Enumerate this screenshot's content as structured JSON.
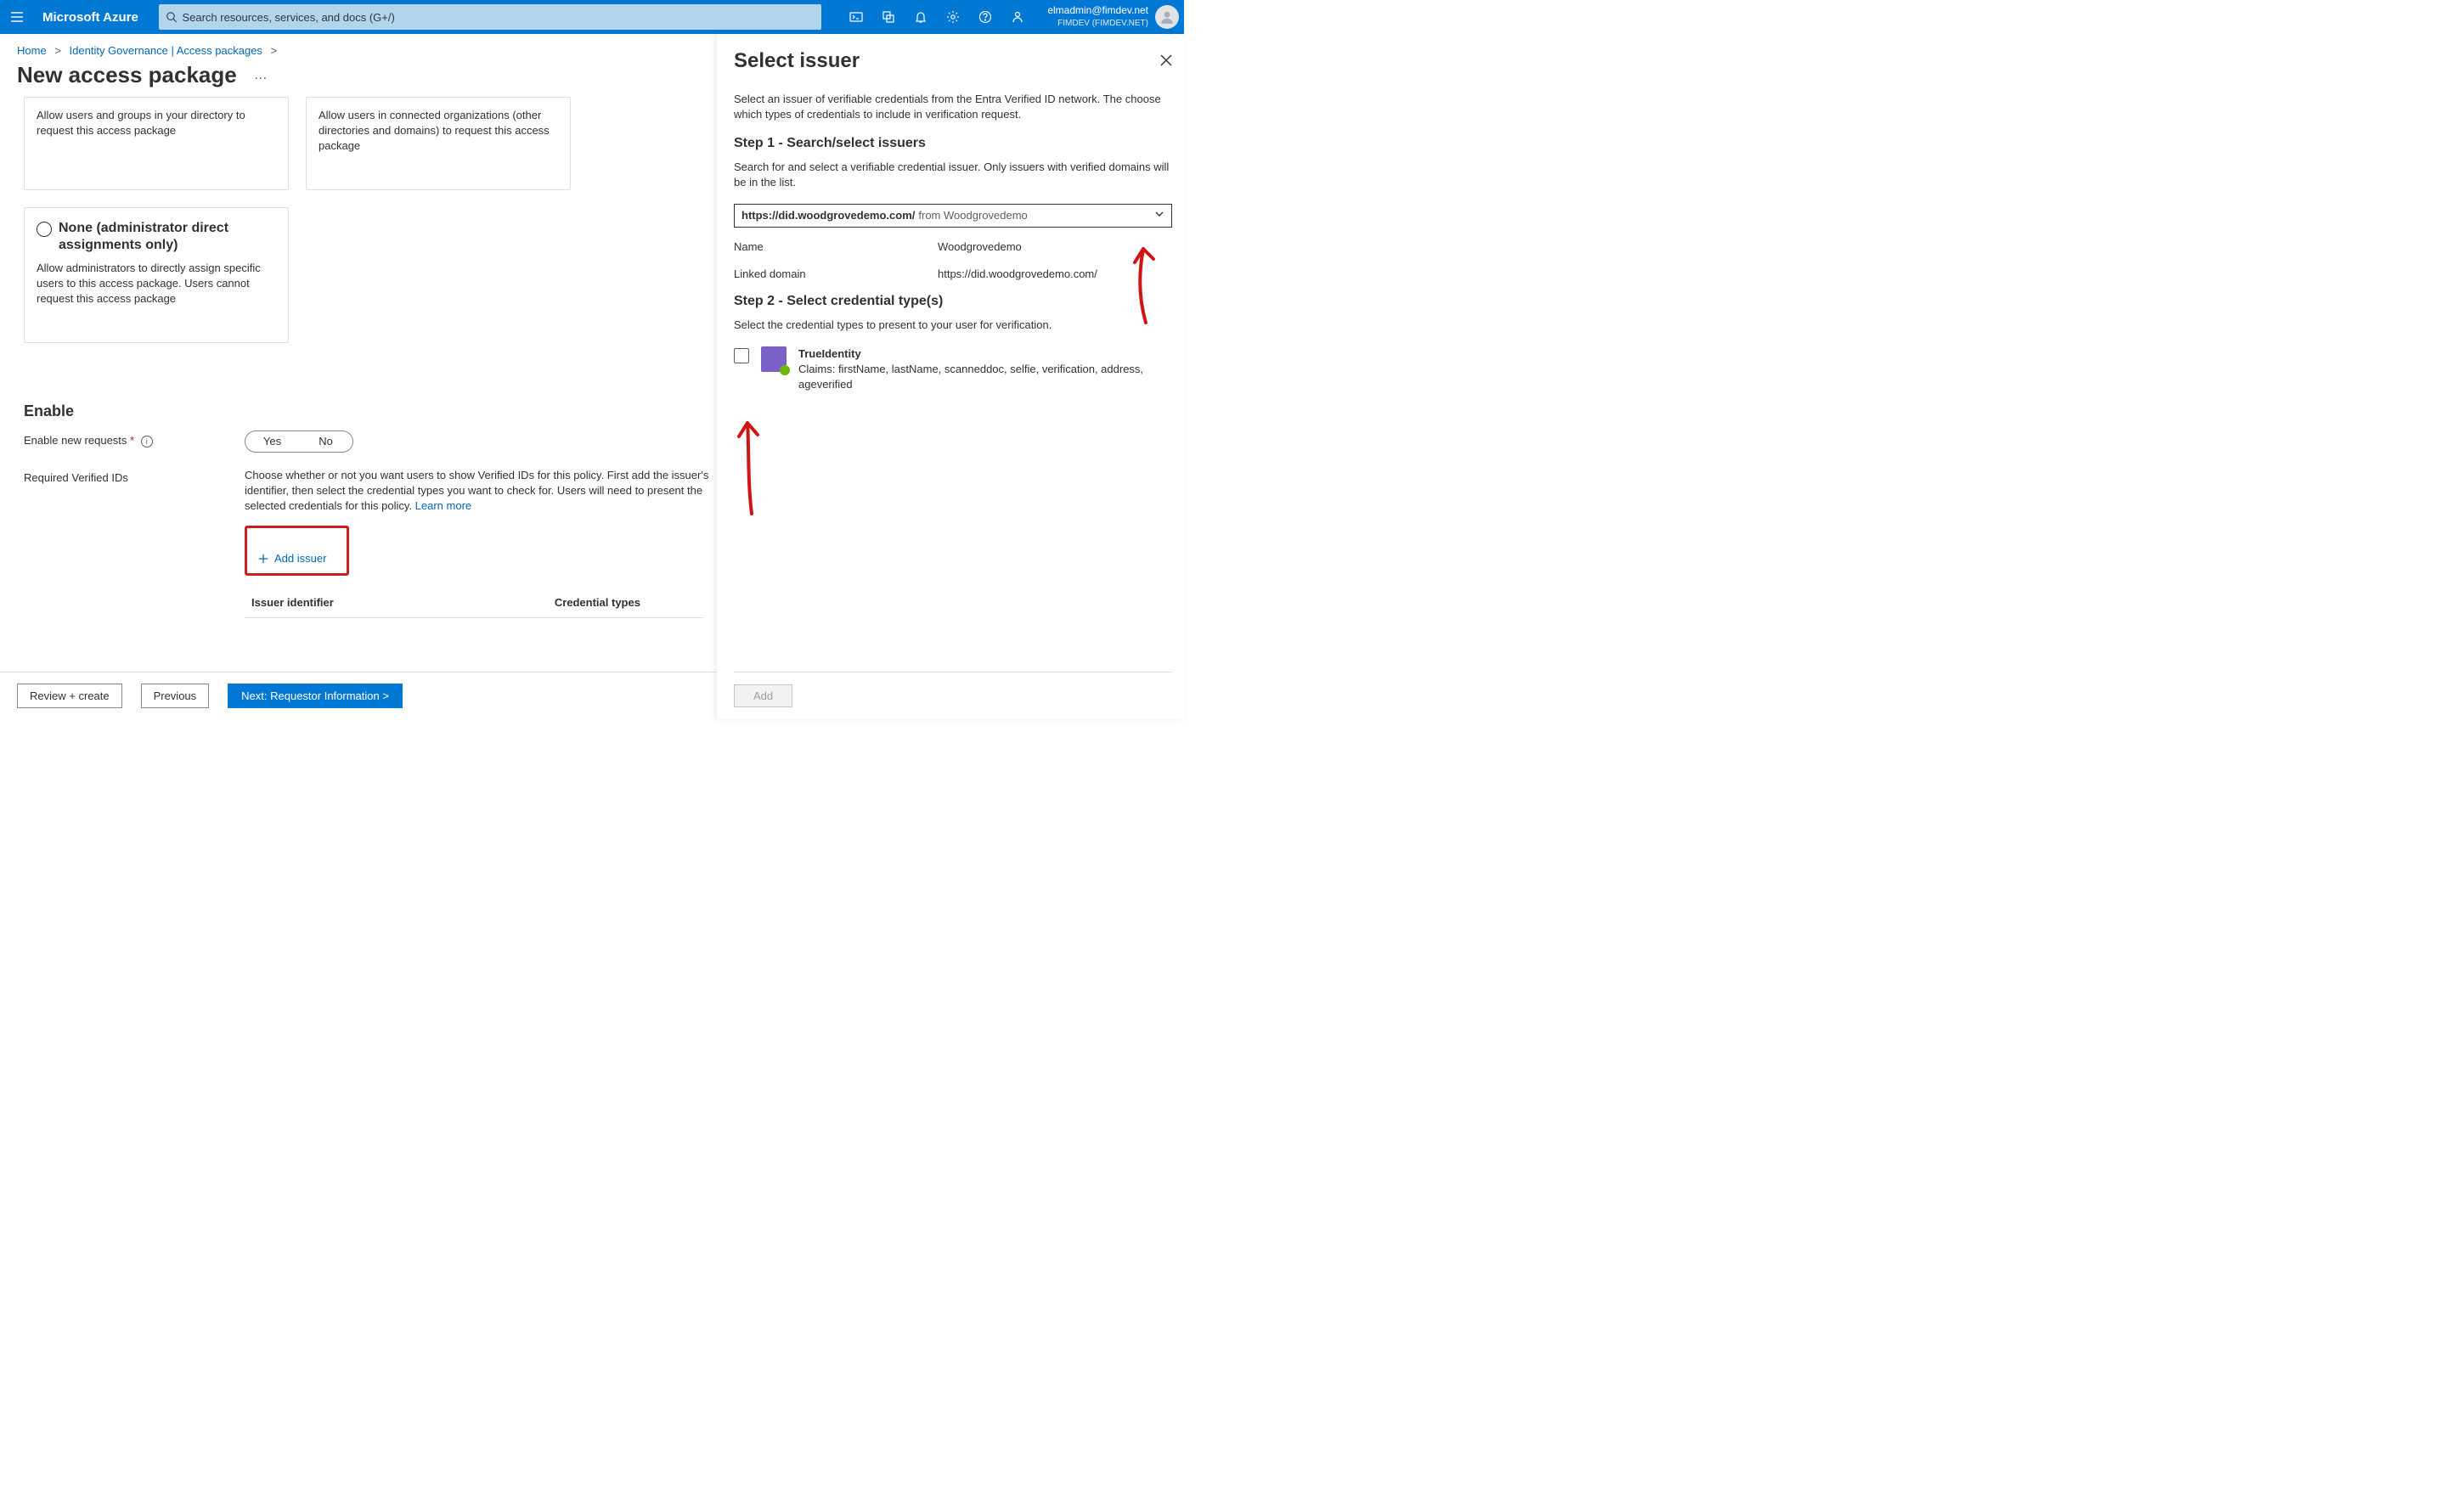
{
  "topbar": {
    "brand": "Microsoft Azure",
    "search_placeholder": "Search resources, services, and docs (G+/)",
    "user_email": "elmadmin@fimdev.net",
    "tenant": "FIMDEV (FIMDEV.NET)"
  },
  "breadcrumb": {
    "home": "Home",
    "gov": "Identity Governance | Access packages"
  },
  "page": {
    "title": "New access package",
    "card1": "Allow users and groups in your directory to request this access package",
    "card2": "Allow users in connected organizations (other directories and domains) to request this access package",
    "option_title": "None (administrator direct assignments only)",
    "option_desc": "Allow administrators to directly assign specific users to this access package. Users cannot request this access package"
  },
  "enable": {
    "section": "Enable",
    "label": "Enable new requests",
    "yes": "Yes",
    "no": "No"
  },
  "verified": {
    "label": "Required Verified IDs",
    "desc": "Choose whether or not you want users to show Verified IDs for this policy. First add the issuer's identifier, then select the credential types you want to check for. Users will need to present the selected credentials for this policy.",
    "learn_more": "Learn more",
    "add_issuer": "Add issuer",
    "col_issuer": "Issuer identifier",
    "col_cred": "Credential types"
  },
  "buttons": {
    "review": "Review + create",
    "previous": "Previous",
    "next": "Next: Requestor Information >"
  },
  "panel": {
    "title": "Select issuer",
    "intro": "Select an issuer of verifiable credentials from the Entra Verified ID network. The choose which types of credentials to include in verification request.",
    "step1": "Step 1 - Search/select issuers",
    "step1_desc": "Search for and select a verifiable credential issuer. Only issuers with verified domains will be in the list.",
    "combo_main": "https://did.woodgrovedemo.com/",
    "combo_sub": "from  Woodgrovedemo",
    "name_label": "Name",
    "name_value": "Woodgrovedemo",
    "domain_label": "Linked domain",
    "domain_value": "https://did.woodgrovedemo.com/",
    "step2": "Step 2 - Select credential type(s)",
    "step2_desc": "Select the credential types to present to your user for verification.",
    "cred_title": "TrueIdentity",
    "cred_claims": "Claims: firstName, lastName, scanneddoc, selfie, verification, address, ageverified",
    "add": "Add"
  }
}
